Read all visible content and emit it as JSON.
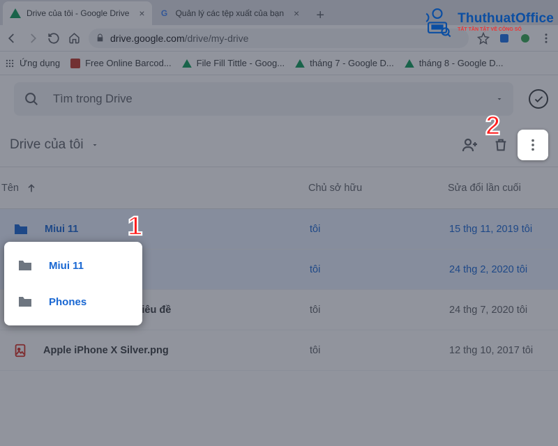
{
  "browser": {
    "tabs": [
      {
        "title": "Drive của tôi - Google Drive",
        "active": true
      },
      {
        "title": "Quản lý các tệp xuất của bạn",
        "active": false
      }
    ],
    "url_host": "drive.google.com",
    "url_path": "/drive/my-drive",
    "bookmarks_label": "Ứng dụng",
    "bookmarks": [
      {
        "label": "Free Online Barcod...",
        "icon": "red"
      },
      {
        "label": "File Fill Tittle - Goog...",
        "icon": "drive"
      },
      {
        "label": "tháng 7 - Google D...",
        "icon": "drive"
      },
      {
        "label": "tháng 8 - Google D...",
        "icon": "drive"
      }
    ]
  },
  "drive": {
    "search_placeholder": "Tìm trong Drive",
    "title": "Drive của tôi",
    "columns": {
      "name": "Tên",
      "owner": "Chủ sở hữu",
      "modified": "Sửa đổi lần cuối"
    },
    "rows": [
      {
        "name": "Miui 11",
        "type": "folder",
        "owner": "tôi",
        "modified": "15 thg 11, 2019  tôi",
        "selected": true
      },
      {
        "name": "Phones",
        "type": "folder",
        "owner": "tôi",
        "modified": "24 thg 2, 2020  tôi",
        "selected": true
      },
      {
        "name": "Thư mục không có tiêu đề",
        "type": "folder-shared",
        "owner": "tôi",
        "modified": "24 thg 7, 2020  tôi",
        "selected": false
      },
      {
        "name": "Apple iPhone X Silver.png",
        "type": "image",
        "owner": "tôi",
        "modified": "12 thg 10, 2017  tôi",
        "selected": false
      }
    ],
    "selected_popup": [
      "Miui 11",
      "Phones"
    ]
  },
  "annotations": {
    "one": "1",
    "two": "2"
  },
  "watermark": {
    "main": "ThuthuatOffice",
    "sub": "TẤT TẦN TẬT VỀ CÔNG SỐ"
  }
}
